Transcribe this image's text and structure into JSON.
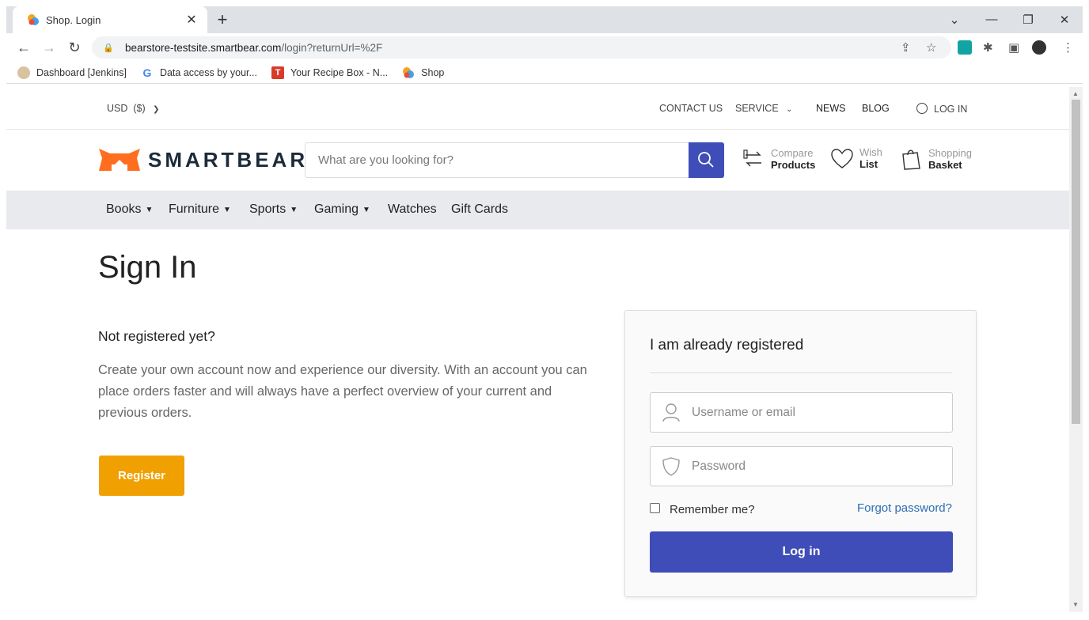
{
  "browser": {
    "tab_title": "Shop. Login",
    "url_host": "bearstore-testsite.smartbear.com",
    "url_path": "/login?returnUrl=%2F",
    "bookmarks": [
      {
        "label": "Dashboard [Jenkins]",
        "icon": "jenkins-icon"
      },
      {
        "label": "Data access by your...",
        "icon": "google-icon"
      },
      {
        "label": "Your Recipe Box - N...",
        "icon": "nyt-icon"
      },
      {
        "label": "Shop",
        "icon": "shop-icon"
      }
    ]
  },
  "topbar": {
    "currency": "USD  ($)",
    "contact": "CONTACT US",
    "service": "SERVICE",
    "news": "NEWS",
    "blog": "BLOG",
    "login": "LOG IN"
  },
  "header": {
    "logo_text": "SMARTBEAR",
    "search_placeholder": "What are you looking for?",
    "compare_top": "Compare",
    "compare_bottom": "Products",
    "wish_top": "Wish",
    "wish_bottom": "List",
    "basket_top": "Shopping",
    "basket_bottom": "Basket"
  },
  "categories": [
    "Books",
    "Furniture",
    "Sports",
    "Gaming",
    "Watches",
    "Gift Cards"
  ],
  "main": {
    "title": "Sign In",
    "not_registered": "Not registered yet?",
    "register_text": "Create your own account now and experience our diversity. With an account you can place orders faster and will always have a perfect overview of your current and previous orders.",
    "register_button": "Register"
  },
  "login_card": {
    "title": "I am already registered",
    "username_placeholder": "Username or email",
    "password_placeholder": "Password",
    "remember_label": "Remember me?",
    "forgot_link": "Forgot password?",
    "login_button": "Log in"
  },
  "colors": {
    "brand_blue": "#3f4db8",
    "register_orange": "#f0a000",
    "logo_orange": "#ff6e1f",
    "link_blue": "#2e6db4"
  }
}
